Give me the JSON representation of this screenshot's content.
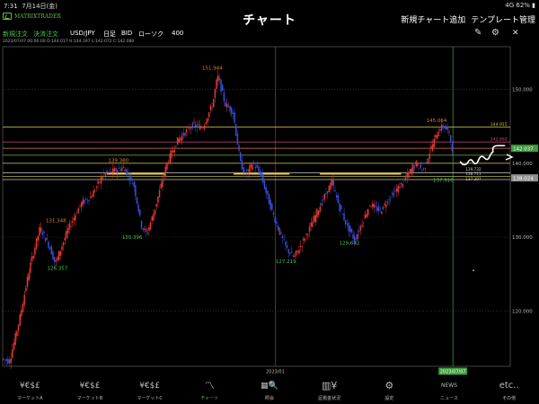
{
  "status_bar": {
    "time": "7:31",
    "date": "7月14日(金)",
    "network": "4G",
    "battery": "62%"
  },
  "header": {
    "logo_text": "MATRIXTRADER",
    "title": "チャート",
    "add_chart": "新規チャート追加",
    "template": "テンプレート管理"
  },
  "toolbar": {
    "new_order": "新規注文",
    "settle_order": "決済注文",
    "pair": "USD/JPY",
    "period": "日足",
    "side": "BID",
    "candle_type": "ローソク",
    "count": "400"
  },
  "ohlc_line": "2023/07/07 00:00:00   O:144.017   H:144.197   L:142.072   C:142.080",
  "chart_data": {
    "type": "candlestick",
    "pair": "USD/JPY",
    "ylim": [
      112.5,
      155.8
    ],
    "yticks": [
      "150.000",
      "140.000",
      "130.000",
      "120.000"
    ],
    "ytick_values": [
      150,
      140,
      130,
      120
    ],
    "xlabels": [
      {
        "text": "2023/01",
        "t": 0.537
      },
      {
        "text": "2023/07/07",
        "t": 0.887,
        "highlight": true
      }
    ],
    "path_points": [
      [
        0,
        113.5
      ],
      [
        0.015,
        113.2
      ],
      [
        0.035,
        119
      ],
      [
        0.055,
        126
      ],
      [
        0.075,
        131.3
      ],
      [
        0.095,
        128.5
      ],
      [
        0.105,
        126.4
      ],
      [
        0.13,
        131
      ],
      [
        0.155,
        134.5
      ],
      [
        0.175,
        135.5
      ],
      [
        0.2,
        138.5
      ],
      [
        0.24,
        139.4
      ],
      [
        0.26,
        137
      ],
      [
        0.275,
        131.5
      ],
      [
        0.285,
        130.4
      ],
      [
        0.3,
        133.5
      ],
      [
        0.325,
        140
      ],
      [
        0.345,
        143
      ],
      [
        0.375,
        145.2
      ],
      [
        0.395,
        144.8
      ],
      [
        0.415,
        148
      ],
      [
        0.425,
        151.9
      ],
      [
        0.44,
        148
      ],
      [
        0.455,
        147
      ],
      [
        0.47,
        140
      ],
      [
        0.48,
        138.5
      ],
      [
        0.495,
        140
      ],
      [
        0.51,
        138.5
      ],
      [
        0.525,
        135
      ],
      [
        0.545,
        131
      ],
      [
        0.56,
        128.5
      ],
      [
        0.575,
        127.2
      ],
      [
        0.59,
        129
      ],
      [
        0.605,
        131
      ],
      [
        0.625,
        134
      ],
      [
        0.65,
        137.5
      ],
      [
        0.665,
        134
      ],
      [
        0.68,
        131.5
      ],
      [
        0.695,
        129.6
      ],
      [
        0.71,
        132
      ],
      [
        0.725,
        134.5
      ],
      [
        0.745,
        133.5
      ],
      [
        0.765,
        135.5
      ],
      [
        0.785,
        137
      ],
      [
        0.8,
        138.5
      ],
      [
        0.815,
        140
      ],
      [
        0.83,
        139
      ],
      [
        0.845,
        142
      ],
      [
        0.86,
        144.5
      ],
      [
        0.87,
        145.1
      ],
      [
        0.88,
        144.2
      ],
      [
        0.887,
        142.08
      ]
    ],
    "price_labels": [
      {
        "text": "151.944",
        "t": 0.413,
        "y": 152.7,
        "color": "#e07b3a"
      },
      {
        "text": "145.064",
        "t": 0.855,
        "y": 145.6,
        "color": "#e07b3a"
      },
      {
        "text": "139.380",
        "t": 0.228,
        "y": 140.2,
        "color": "#e07b3a"
      },
      {
        "text": "131.348",
        "t": 0.105,
        "y": 132.0,
        "color": "#e07b3a"
      },
      {
        "text": "126.357",
        "t": 0.108,
        "y": 125.6,
        "color": "#4fc24f"
      },
      {
        "text": "130.396",
        "t": 0.255,
        "y": 129.8,
        "color": "#4fc24f"
      },
      {
        "text": "127.219",
        "t": 0.558,
        "y": 126.5,
        "color": "#4fc24f"
      },
      {
        "text": "129.642",
        "t": 0.683,
        "y": 129.0,
        "color": "#4fc24f"
      },
      {
        "text": "137.910",
        "t": 0.868,
        "y": 137.5,
        "color": "#4fc24f"
      }
    ],
    "hlines": [
      {
        "y": 144.915,
        "color": "#d9d24a",
        "label": "144.915"
      },
      {
        "y": 142.892,
        "color": "#d24a8a",
        "label": "142.892"
      },
      {
        "y": 142.037,
        "color": "#e07b3a",
        "label": ""
      },
      {
        "y": 141.1,
        "color": "#8aa84a",
        "label": ""
      },
      {
        "y": 140.0,
        "color": "#d9d24a",
        "label": ""
      },
      {
        "y": 138.7,
        "color": "#c9c9c9",
        "label": ""
      },
      {
        "y": 138.25,
        "color": "#d9d24a",
        "label": ""
      },
      {
        "y": 137.8,
        "color": "#c9c9c9",
        "label": ""
      }
    ],
    "yellow_segments": [
      {
        "x1": 0.205,
        "x2": 0.32,
        "y": 138.6
      },
      {
        "x1": 0.455,
        "x2": 0.565,
        "y": 138.6
      },
      {
        "x1": 0.625,
        "x2": 0.785,
        "y": 138.6
      }
    ],
    "small_labels": [
      {
        "text": "139.732",
        "t": 0.912,
        "y": 139.0
      },
      {
        "text": "138.711",
        "t": 0.912,
        "y": 138.4
      },
      {
        "text": "137.397",
        "t": 0.912,
        "y": 137.7
      }
    ],
    "side_labels": [
      {
        "text": "142.037",
        "y": 142.037,
        "bg": "#3c9c3c"
      },
      {
        "text": "138.024",
        "y": 138.024,
        "bg": "#8f8f8f"
      }
    ],
    "vlines": [
      {
        "t": 0.537,
        "color": "#c0392b"
      },
      {
        "t": 0.887,
        "color": "#4fc24f"
      }
    ]
  },
  "nav": {
    "items": [
      {
        "label": "マーケットA",
        "icon": "¥€$£"
      },
      {
        "label": "マーケットB",
        "icon": "¥€$£"
      },
      {
        "label": "マーケットC",
        "icon": "¥€$£"
      },
      {
        "label": "チャート",
        "icon": "chart-icon",
        "active": true
      },
      {
        "label": "照会",
        "icon": "search-icon"
      },
      {
        "label": "証拠金状況",
        "icon": "¥"
      },
      {
        "label": "設定",
        "icon": "gear-icon"
      },
      {
        "label": "ニュース",
        "icon": "NEWS"
      },
      {
        "label": "その他",
        "icon": "etc..."
      }
    ]
  }
}
